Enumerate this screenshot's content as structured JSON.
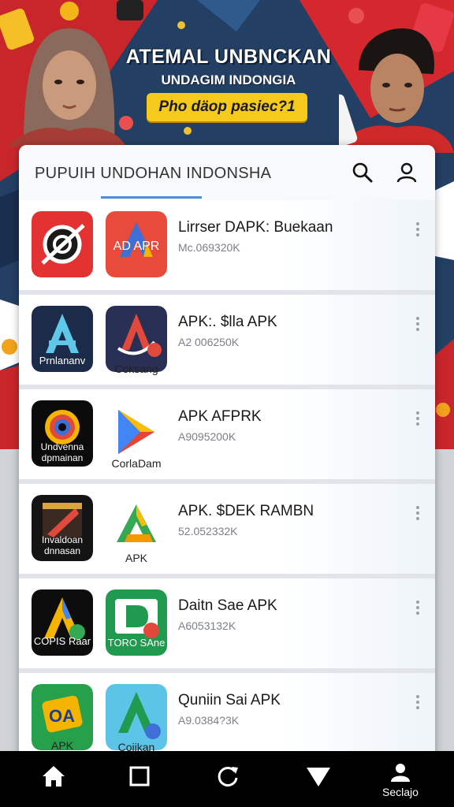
{
  "banner": {
    "title": "ATEMAL UNBNCKAN",
    "subtitle": "UNDAGIM INDONGIA",
    "pill": "Pho däop pasiec?1"
  },
  "header": {
    "title": "PUPUIH UNDOHAN INDONSHA",
    "search_icon": "search-icon",
    "account_icon": "user-icon"
  },
  "apps": [
    {
      "name": "Lirrser DAPK: Buekaan",
      "meta": "Mc.069320K",
      "icon_a_caption": "",
      "icon_b_caption": "AD APR",
      "colors": [
        "#e23232",
        "#e84b3c"
      ]
    },
    {
      "name": "APK:. $lla APK",
      "meta": "A2 006250K",
      "icon_a_caption": "Prnlananv",
      "icon_b_caption": "Coksang",
      "colors": [
        "#1d2b4a",
        "#2a2f55"
      ]
    },
    {
      "name": "APK AFPRK",
      "meta": "A9095200K",
      "icon_a_caption": "Undvenna dpmainan",
      "icon_b_caption": "CorlaDam",
      "colors": [
        "#0b0b0b",
        "#ffffff"
      ]
    },
    {
      "name": "APK. $DEK RAMBN",
      "meta": "52.052332K",
      "icon_a_caption": "Invaldoan dnnasan",
      "icon_b_caption": "APK",
      "colors": [
        "#141414",
        "#ffffff"
      ]
    },
    {
      "name": "Daitn Sae APK",
      "meta": "A6053132K",
      "icon_a_caption": "COPIS Raar",
      "icon_b_caption": "TORO SAne",
      "colors": [
        "#0d0d0d",
        "#1f9a4e"
      ]
    },
    {
      "name": "Quniin Sai APK",
      "meta": "A9.0384?3K",
      "icon_a_caption": "APK",
      "icon_b_caption": "Cojikan",
      "colors": [
        "#27a04c",
        "#5cc4e6"
      ]
    }
  ],
  "nav": {
    "items": [
      {
        "icon": "home-icon",
        "label": ""
      },
      {
        "icon": "square-icon",
        "label": ""
      },
      {
        "icon": "refresh-icon",
        "label": ""
      },
      {
        "icon": "triangle-down-icon",
        "label": ""
      },
      {
        "icon": "profile-icon",
        "label": "Seclajo"
      }
    ]
  }
}
